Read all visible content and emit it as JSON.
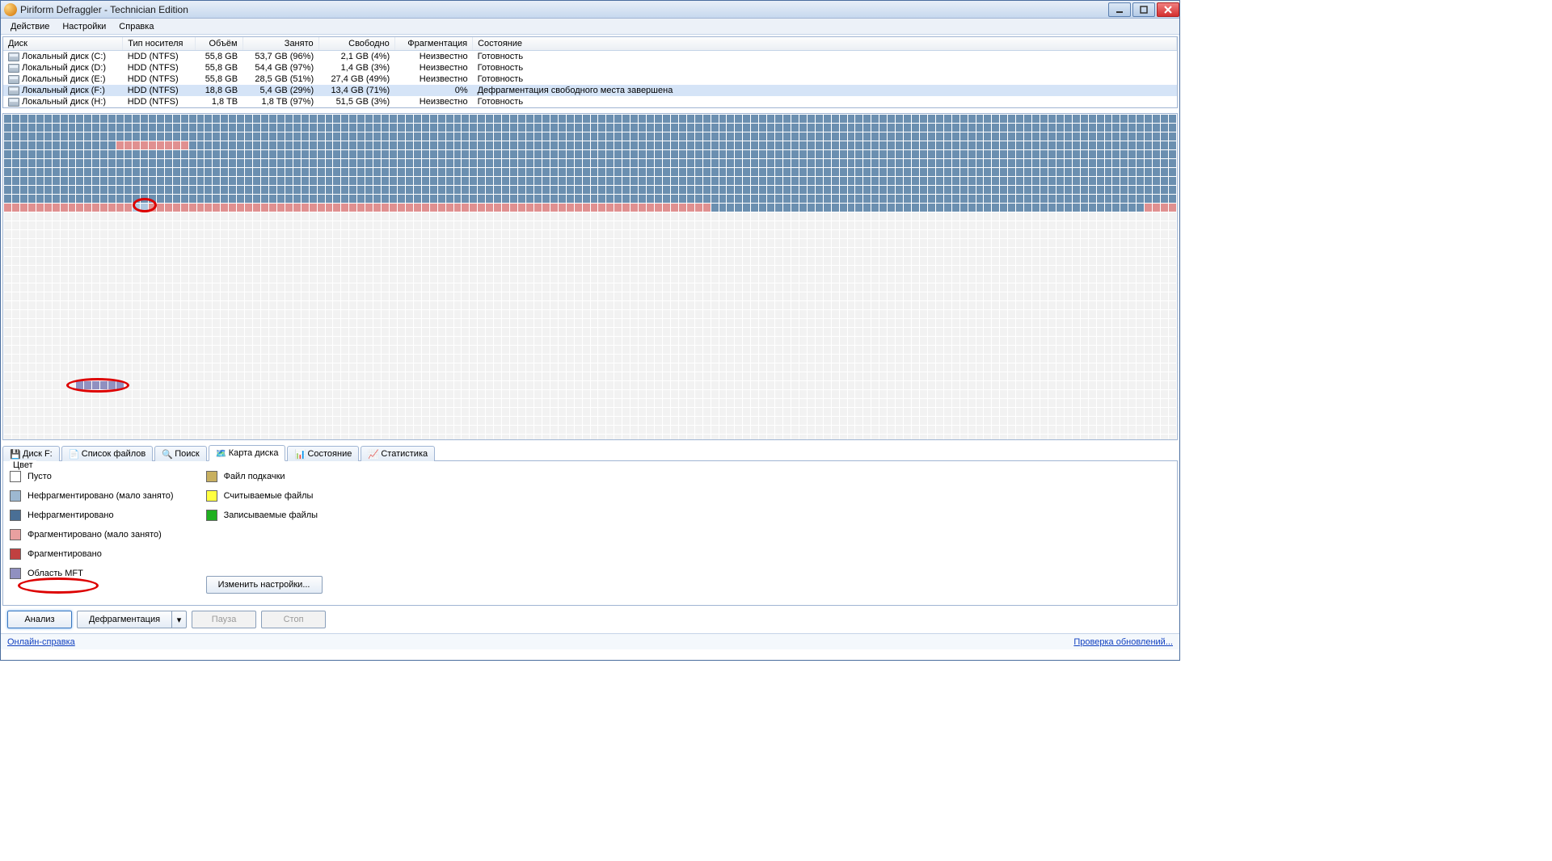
{
  "window": {
    "title": "Piriform Defraggler - Technician Edition"
  },
  "menu": {
    "items": [
      "Действие",
      "Настройки",
      "Справка"
    ]
  },
  "disk_table": {
    "headers": [
      "Диск",
      "Тип носителя",
      "Объём",
      "Занято",
      "Свободно",
      "Фрагментация",
      "Состояние"
    ],
    "rows": [
      {
        "name": "Локальный диск (C:)",
        "media": "HDD (NTFS)",
        "size": "55,8 GB",
        "used": "53,7 GB (96%)",
        "free": "2,1 GB (4%)",
        "frag": "Неизвестно",
        "state": "Готовность"
      },
      {
        "name": "Локальный диск (D:)",
        "media": "HDD (NTFS)",
        "size": "55,8 GB",
        "used": "54,4 GB (97%)",
        "free": "1,4 GB (3%)",
        "frag": "Неизвестно",
        "state": "Готовность"
      },
      {
        "name": "Локальный диск (E:)",
        "media": "HDD (NTFS)",
        "size": "55,8 GB",
        "used": "28,5 GB (51%)",
        "free": "27,4 GB (49%)",
        "frag": "Неизвестно",
        "state": "Готовность"
      },
      {
        "name": "Локальный диск (F:)",
        "media": "HDD (NTFS)",
        "size": "18,8 GB",
        "used": "5,4 GB (29%)",
        "free": "13,4 GB (71%)",
        "frag": "0%",
        "state": "Дефрагментация свободного места завершена"
      },
      {
        "name": "Локальный диск (H:)",
        "media": "HDD (NTFS)",
        "size": "1,8 TB",
        "used": "1,8 TB (97%)",
        "free": "51,5 GB (3%)",
        "frag": "Неизвестно",
        "state": "Готовность"
      }
    ],
    "selected_index": 3
  },
  "tabs": {
    "items": [
      "Диск F:",
      "Список файлов",
      "Поиск",
      "Карта диска",
      "Состояние",
      "Статистика"
    ],
    "active_index": 3
  },
  "legend": {
    "title": "Цвет",
    "col1": [
      {
        "label": "Пусто",
        "color": "#ffffff"
      },
      {
        "label": "Нефрагментировано (мало занято)",
        "color": "#9db8d0"
      },
      {
        "label": "Нефрагментировано",
        "color": "#4a6f95"
      },
      {
        "label": "Фрагментировано (мало занято)",
        "color": "#e8a0a0"
      },
      {
        "label": "Фрагментировано",
        "color": "#c04040"
      },
      {
        "label": "Область MFT",
        "color": "#9090c0"
      }
    ],
    "col2": [
      {
        "label": "Файл подкачки",
        "color": "#c8b060"
      },
      {
        "label": "Считываемые файлы",
        "color": "#ffff40"
      },
      {
        "label": "Записываемые файлы",
        "color": "#20b020"
      }
    ],
    "settings_btn": "Изменить настройки..."
  },
  "actions": {
    "analyze": "Анализ",
    "defrag": "Дефрагментация",
    "pause": "Пауза",
    "stop": "Стоп"
  },
  "statusbar": {
    "help": "Онлайн-справка",
    "update": "Проверка обновлений..."
  },
  "colors": {
    "nf": "#6b8fb0",
    "highlight": "#b0c8e0",
    "frl": "#e09090",
    "empty": "#f2f2f2",
    "mft": "#9090c0"
  }
}
